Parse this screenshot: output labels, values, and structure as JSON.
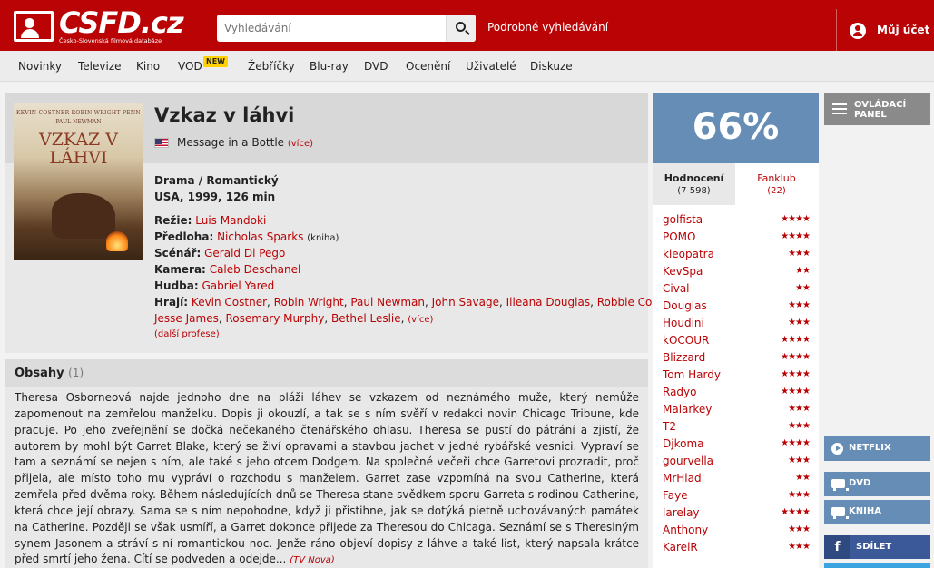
{
  "header": {
    "logo_text": "CSFD.cz",
    "logo_subtitle": "Česko-Slovenská filmová databáze",
    "search_placeholder": "Vyhledávání",
    "advanced_search": "Podrobné vyhledávání",
    "account": "Můj účet"
  },
  "nav": {
    "items": [
      "Novinky",
      "Televize",
      "Kino",
      "VOD",
      "Žebříčky",
      "Blu-ray",
      "DVD",
      "Ocenění",
      "Uživatelé",
      "Diskuze"
    ],
    "vod_badge": "NEW"
  },
  "movie": {
    "poster_cast_1": "KEVIN COSTNER    ROBIN WRIGHT PENN",
    "poster_cast_2": "PAUL NEWMAN",
    "poster_title": "VZKAZ V LÁHVI",
    "title": "Vzkaz v láhvi",
    "alt_title": "Message in a Bottle",
    "alt_more": "(více)",
    "genre": "Drama / Romantický",
    "origin": "USA, 1999, 126 min",
    "credits": {
      "director_label": "Režie:",
      "director": "Luis Mandoki",
      "source_label": "Předloha:",
      "source": "Nicholas Sparks",
      "source_note": "(kniha)",
      "writer_label": "Scénář:",
      "writer": "Gerald Di Pego",
      "camera_label": "Kamera:",
      "camera": "Caleb Deschanel",
      "music_label": "Hudba:",
      "music": "Gabriel Yared",
      "cast_label": "Hrají:",
      "cast": [
        "Kevin Costner",
        "Robin Wright",
        "Paul Newman",
        "John Savage",
        "Illeana Douglas",
        "Robbie Coltrane",
        "Jesse James",
        "Rosemary Murphy",
        "Bethel Leslie"
      ],
      "cast_more": "(více)",
      "other_professions": "(další profese)"
    }
  },
  "plot": {
    "title": "Obsahy",
    "count": "(1)",
    "text": "Theresa Osborneová najde jednoho dne na pláži láhev se vzkazem od neznámého muže, který nemůže zapomenout na zemřelou manželku. Dopis ji okouzlí, a tak se s ním svěří v redakci novin Chicago Tribune, kde pracuje. Po jeho zveřejnění se dočká nečekaného čtenářského ohlasu. Theresa se pustí do pátrání a zjistí, že autorem by mohl být Garret Blake, který se živí opravami a stavbou jachet v jedné rybářské vesnici. Vypraví se tam a seznámí se nejen s ním, ale také s jeho otcem Dodgem. Na společné večeři chce Garretovi prozradit, proč přijela, ale místo toho mu vypráví o rozchodu s manželem. Garret zase vzpomíná na svou Catherine, která zemřela před dvěma roky. Během následujících dnů se Theresa stane svědkem sporu Garreta s rodinou Catherine, která chce její obrazy. Sama se s ním nepohodne, když ji přistihne, jak se dotýká pietně uchovávaných památek na Catherine. Později se však usmíří, a Garret dokonce přijede za Theresou do Chicaga. Seznámí se s Theresiným synem Jasonem a stráví s ní romantickou noc. Jenže ráno objeví dopisy z láhve a také list, který napsala krátce před smrtí jeho žena. Cítí se podveden a odejde...",
    "source": "(TV Nova)"
  },
  "rating": {
    "percent": "66%",
    "tab_ratings": "Hodnocení",
    "tab_ratings_count": "(7 598)",
    "tab_fanclub": "Fanklub",
    "tab_fanclub_count": "(22)",
    "users": [
      {
        "name": "golfista",
        "stars": "★★★★"
      },
      {
        "name": "POMO",
        "stars": "★★★★"
      },
      {
        "name": "kleopatra",
        "stars": "★★★"
      },
      {
        "name": "KevSpa",
        "stars": "★★"
      },
      {
        "name": "Cival",
        "stars": "★★"
      },
      {
        "name": "Douglas",
        "stars": "★★★"
      },
      {
        "name": "Houdini",
        "stars": "★★★"
      },
      {
        "name": "kOCOUR",
        "stars": "★★★★"
      },
      {
        "name": "Blizzard",
        "stars": "★★★★"
      },
      {
        "name": "Tom Hardy",
        "stars": "★★★★"
      },
      {
        "name": "Radyo",
        "stars": "★★★★"
      },
      {
        "name": "Malarkey",
        "stars": "★★★"
      },
      {
        "name": "T2",
        "stars": "★★★"
      },
      {
        "name": "Djkoma",
        "stars": "★★★★"
      },
      {
        "name": "gourvella",
        "stars": "★★★"
      },
      {
        "name": "MrHlad",
        "stars": "★★"
      },
      {
        "name": "Faye",
        "stars": "★★★"
      },
      {
        "name": "larelay",
        "stars": "★★★★"
      },
      {
        "name": "Anthony",
        "stars": "★★★"
      },
      {
        "name": "KarelR",
        "stars": "★★★"
      }
    ]
  },
  "side": {
    "control_panel": "OVLÁDACÍ PANEL",
    "netflix": "NETFLIX",
    "dvd": "DVD",
    "book": "KNIHA",
    "share": "SDÍLET"
  }
}
